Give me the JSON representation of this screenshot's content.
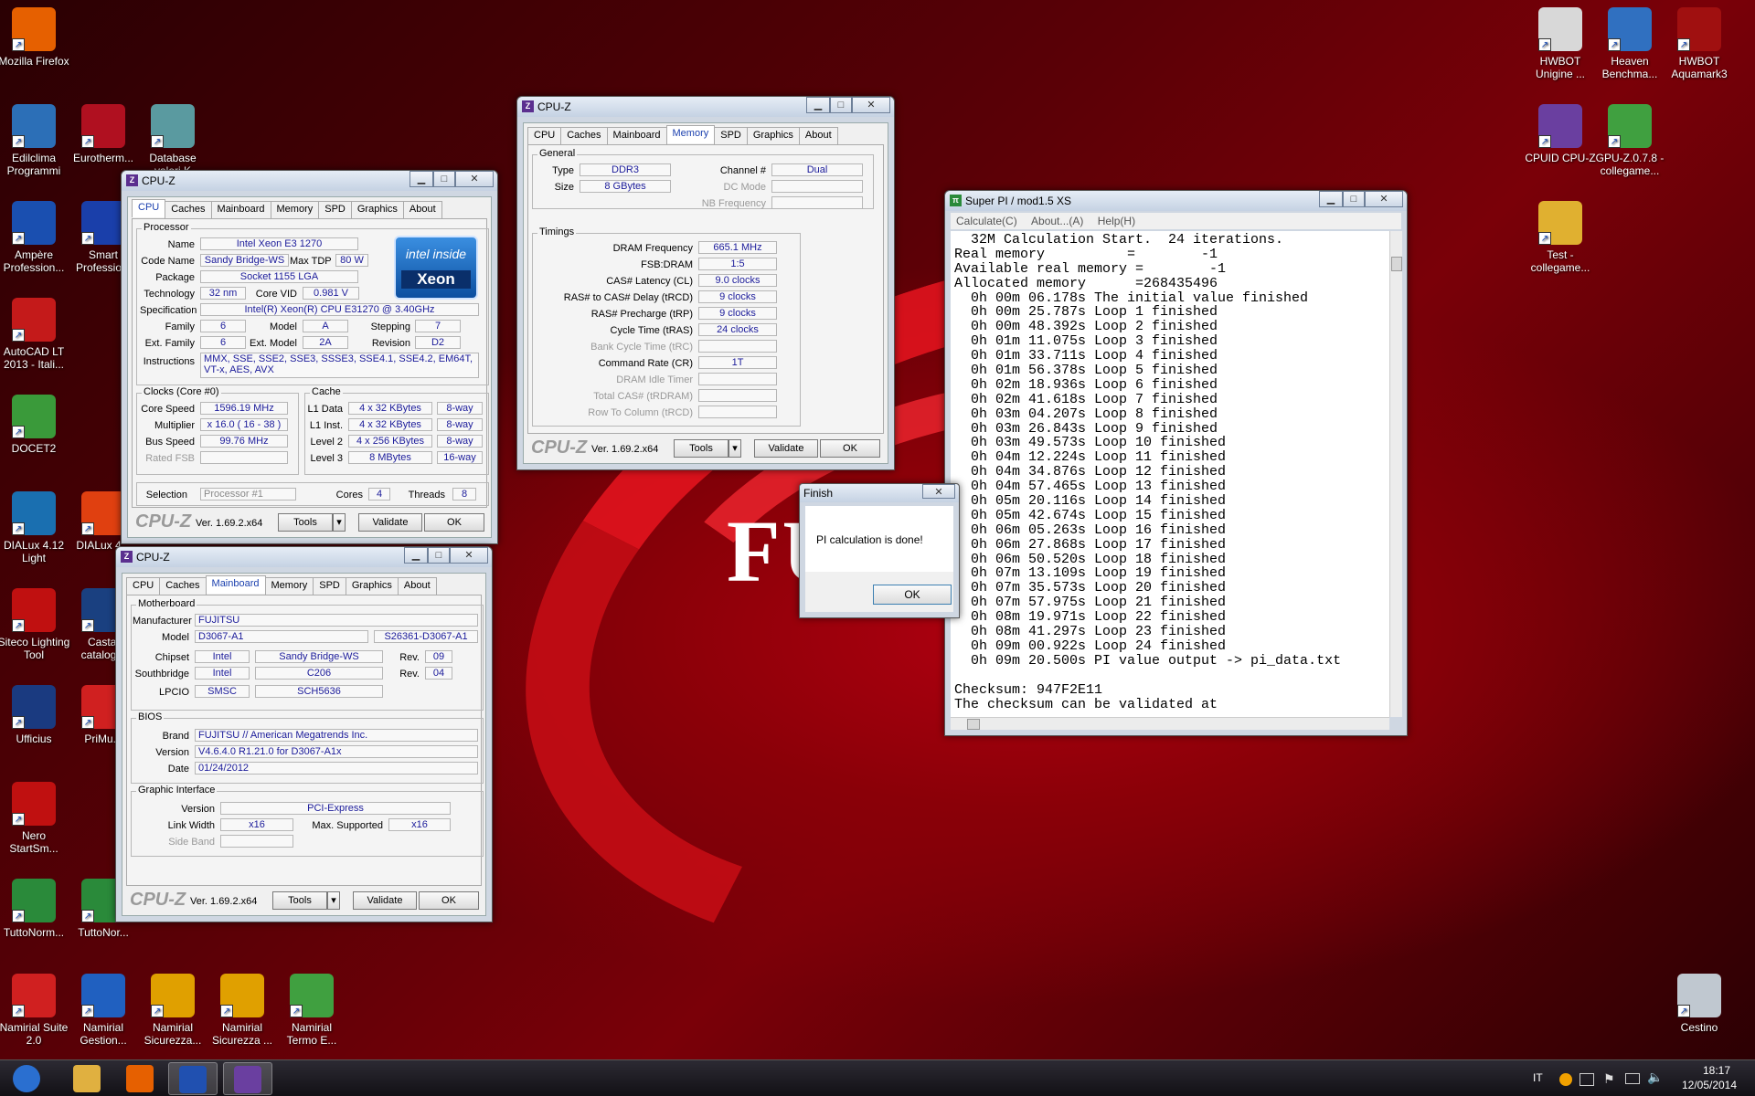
{
  "wallpaper": {
    "brand": "FUJ"
  },
  "desktop_icons": [
    {
      "label": "Mozilla Firefox",
      "icon": "firefox-icon",
      "color": "#e66000"
    },
    {
      "label": "Edilclima Programmi",
      "icon": "edilclima-icon",
      "color": "#2c6fb7"
    },
    {
      "label": "Eurotherm...",
      "icon": "eurotherm-icon",
      "color": "#b01020"
    },
    {
      "label": "Database valori K",
      "icon": "database-icon",
      "color": "#5a9aa0"
    },
    {
      "label": "Ampère Profession...",
      "icon": "ampere-icon",
      "color": "#1a4fb0"
    },
    {
      "label": "Smart Professio...",
      "icon": "smart-icon",
      "color": "#1a3faa"
    },
    {
      "label": "AutoCAD LT 2013 - Itali...",
      "icon": "autocad-icon",
      "color": "#c41a1a"
    },
    {
      "label": "DOCET2",
      "icon": "docet-icon",
      "color": "#3a9a3a"
    },
    {
      "label": "DIALux 4.12 Light",
      "icon": "dialux-icon",
      "color": "#1a6fb0"
    },
    {
      "label": "DIALux 4...",
      "icon": "dialux2-icon",
      "color": "#e04010"
    },
    {
      "label": "Siteco Lighting Tool",
      "icon": "siteco-icon",
      "color": "#c01010"
    },
    {
      "label": "Castal catalog...",
      "icon": "castal-icon",
      "color": "#1a4080"
    },
    {
      "label": "Ufficius",
      "icon": "ufficius-icon",
      "color": "#1a3a80"
    },
    {
      "label": "PriMu...",
      "icon": "primus-icon",
      "color": "#d02020"
    },
    {
      "label": "Nero StartSm...",
      "icon": "nero-icon",
      "color": "#c01010"
    },
    {
      "label": "TuttoNorm...",
      "icon": "tuttonorm-icon",
      "color": "#2a8a3a"
    },
    {
      "label": "TuttoNor...",
      "icon": "tuttonorm2-icon",
      "color": "#2a8a3a"
    },
    {
      "label": "Namirial Suite 2.0",
      "icon": "namirial-icon",
      "color": "#d02020"
    },
    {
      "label": "Namirial Gestion...",
      "icon": "namirial-gestion-icon",
      "color": "#2060c0"
    },
    {
      "label": "Namirial Sicurezza...",
      "icon": "namirial-sicurezza-icon",
      "color": "#e0a000"
    },
    {
      "label": "Namirial Sicurezza ...",
      "icon": "namirial-sicurezza2-icon",
      "color": "#e0a000"
    },
    {
      "label": "Namirial Termo E...",
      "icon": "namirial-termo-icon",
      "color": "#40a040"
    },
    {
      "label": "HWBOT Unigine ...",
      "icon": "hwbot-unigine-icon",
      "color": "#d8d8d8"
    },
    {
      "label": "Heaven Benchma...",
      "icon": "heaven-icon",
      "color": "#3070c0"
    },
    {
      "label": "HWBOT Aquamark3",
      "icon": "aquamark-icon",
      "color": "#a01010"
    },
    {
      "label": "CPUID CPU-Z",
      "icon": "cpuz-icon",
      "color": "#6a3fa0"
    },
    {
      "label": "GPU-Z.0.7.8 - collegame...",
      "icon": "gpuz-icon",
      "color": "#40a040"
    },
    {
      "label": "Test - collegame...",
      "icon": "folder-icon",
      "color": "#e0b030"
    },
    {
      "label": "Cestino",
      "icon": "recycle-bin-icon",
      "color": "#c0c8d0"
    }
  ],
  "cpuz_cpu": {
    "title": "CPU-Z",
    "tabs": [
      "CPU",
      "Caches",
      "Mainboard",
      "Memory",
      "SPD",
      "Graphics",
      "About"
    ],
    "processor_label": "Processor",
    "name_label": "Name",
    "name": "Intel Xeon E3 1270",
    "codename_label": "Code Name",
    "codename": "Sandy Bridge-WS",
    "maxtdp_label": "Max TDP",
    "maxtdp": "80 W",
    "package_label": "Package",
    "package": "Socket 1155 LGA",
    "tech_label": "Technology",
    "tech": "32 nm",
    "vid_label": "Core VID",
    "vid": "0.981 V",
    "spec_label": "Specification",
    "spec": "Intel(R) Xeon(R) CPU E31270 @ 3.40GHz",
    "family_label": "Family",
    "family": "6",
    "model_label": "Model",
    "model": "A",
    "stepping_label": "Stepping",
    "stepping": "7",
    "extfamily_label": "Ext. Family",
    "extfamily": "6",
    "extmodel_label": "Ext. Model",
    "extmodel": "2A",
    "revision_label": "Revision",
    "revision": "D2",
    "instr_label": "Instructions",
    "instr": "MMX, SSE, SSE2, SSE3, SSSE3, SSE4.1, SSE4.2, EM64T, VT-x, AES, AVX",
    "clocks_label": "Clocks (Core #0)",
    "corespeed_label": "Core Speed",
    "corespeed": "1596.19 MHz",
    "mult_label": "Multiplier",
    "mult": "x 16.0 ( 16 - 38 )",
    "bus_label": "Bus Speed",
    "bus": "99.76 MHz",
    "fsb_label": "Rated FSB",
    "fsb": "",
    "cache_label": "Cache",
    "l1d_label": "L1 Data",
    "l1d": "4 x 32 KBytes",
    "l1d_way": "8-way",
    "l1i_label": "L1 Inst.",
    "l1i": "4 x 32 KBytes",
    "l1i_way": "8-way",
    "l2_label": "Level 2",
    "l2": "4 x 256 KBytes",
    "l2_way": "8-way",
    "l3_label": "Level 3",
    "l3": "8 MBytes",
    "l3_way": "16-way",
    "selection_label": "Selection",
    "selection": "Processor #1",
    "cores_label": "Cores",
    "cores": "4",
    "threads_label": "Threads",
    "threads": "8",
    "logo": "CPU-Z",
    "version": "Ver. 1.69.2.x64",
    "tools": "Tools",
    "validate": "Validate",
    "ok": "OK",
    "intel_inside": "intel inside",
    "intel_xeon": "Xeon"
  },
  "cpuz_mem": {
    "title": "CPU-Z",
    "tabs": [
      "CPU",
      "Caches",
      "Mainboard",
      "Memory",
      "SPD",
      "Graphics",
      "About"
    ],
    "general_label": "General",
    "type_label": "Type",
    "type": "DDR3",
    "size_label": "Size",
    "size": "8 GBytes",
    "channel_label": "Channel #",
    "channel": "Dual",
    "dcmode_label": "DC Mode",
    "nbfreq_label": "NB Frequency",
    "timings_label": "Timings",
    "rows": [
      {
        "label": "DRAM Frequency",
        "value": "665.1 MHz",
        "dis": false
      },
      {
        "label": "FSB:DRAM",
        "value": "1:5",
        "dis": false
      },
      {
        "label": "CAS# Latency (CL)",
        "value": "9.0 clocks",
        "dis": false
      },
      {
        "label": "RAS# to CAS# Delay (tRCD)",
        "value": "9 clocks",
        "dis": false
      },
      {
        "label": "RAS# Precharge (tRP)",
        "value": "9 clocks",
        "dis": false
      },
      {
        "label": "Cycle Time (tRAS)",
        "value": "24 clocks",
        "dis": false
      },
      {
        "label": "Bank Cycle Time (tRC)",
        "value": "",
        "dis": true
      },
      {
        "label": "Command Rate (CR)",
        "value": "1T",
        "dis": false
      },
      {
        "label": "DRAM Idle Timer",
        "value": "",
        "dis": true
      },
      {
        "label": "Total CAS# (tRDRAM)",
        "value": "",
        "dis": true
      },
      {
        "label": "Row To Column (tRCD)",
        "value": "",
        "dis": true
      }
    ],
    "logo": "CPU-Z",
    "version": "Ver. 1.69.2.x64",
    "tools": "Tools",
    "validate": "Validate",
    "ok": "OK"
  },
  "cpuz_mb": {
    "title": "CPU-Z",
    "tabs": [
      "CPU",
      "Caches",
      "Mainboard",
      "Memory",
      "SPD",
      "Graphics",
      "About"
    ],
    "motherboard_label": "Motherboard",
    "manufacturer_label": "Manufacturer",
    "manufacturer": "FUJITSU",
    "model_label": "Model",
    "model": "D3067-A1",
    "model2": "S26361-D3067-A1",
    "chipset_label": "Chipset",
    "chipset_vendor": "Intel",
    "chipset": "Sandy Bridge-WS",
    "chipset_rev_label": "Rev.",
    "chipset_rev": "09",
    "south_label": "Southbridge",
    "south_vendor": "Intel",
    "south": "C206",
    "south_rev_label": "Rev.",
    "south_rev": "04",
    "lpcio_label": "LPCIO",
    "lpcio_vendor": "SMSC",
    "lpcio": "SCH5636",
    "bios_label": "BIOS",
    "brand_label": "Brand",
    "brand": "FUJITSU // American Megatrends Inc.",
    "version_label": "Version",
    "bios_version": "V4.6.4.0 R1.21.0 for D3067-A1x",
    "date_label": "Date",
    "date": "01/24/2012",
    "gi_label": "Graphic Interface",
    "giver_label": "Version",
    "giver": "PCI-Express",
    "lw_label": "Link Width",
    "lw": "x16",
    "maxsup_label": "Max. Supported",
    "maxsup": "x16",
    "sideband_label": "Side Band",
    "logo": "CPU-Z",
    "version": "Ver. 1.69.2.x64",
    "tools": "Tools",
    "validate": "Validate",
    "ok": "OK"
  },
  "superpi": {
    "title": "Super PI / mod1.5 XS",
    "menu": [
      "Calculate(C)",
      "About...(A)",
      "Help(H)"
    ],
    "lines": [
      "  32M Calculation Start.  24 iterations.",
      "Real memory          =        -1",
      "Available real memory =        -1",
      "Allocated memory      =268435496",
      "  0h 00m 06.178s The initial value finished",
      "  0h 00m 25.787s Loop 1 finished",
      "  0h 00m 48.392s Loop 2 finished",
      "  0h 01m 11.075s Loop 3 finished",
      "  0h 01m 33.711s Loop 4 finished",
      "  0h 01m 56.378s Loop 5 finished",
      "  0h 02m 18.936s Loop 6 finished",
      "  0h 02m 41.618s Loop 7 finished",
      "  0h 03m 04.207s Loop 8 finished",
      "  0h 03m 26.843s Loop 9 finished",
      "  0h 03m 49.573s Loop 10 finished",
      "  0h 04m 12.224s Loop 11 finished",
      "  0h 04m 34.876s Loop 12 finished",
      "  0h 04m 57.465s Loop 13 finished",
      "  0h 05m 20.116s Loop 14 finished",
      "  0h 05m 42.674s Loop 15 finished",
      "  0h 06m 05.263s Loop 16 finished",
      "  0h 06m 27.868s Loop 17 finished",
      "  0h 06m 50.520s Loop 18 finished",
      "  0h 07m 13.109s Loop 19 finished",
      "  0h 07m 35.573s Loop 20 finished",
      "  0h 07m 57.975s Loop 21 finished",
      "  0h 08m 19.971s Loop 22 finished",
      "  0h 08m 41.297s Loop 23 finished",
      "  0h 09m 00.922s Loop 24 finished",
      "  0h 09m 20.500s PI value output -> pi_data.txt",
      "",
      "Checksum: 947F2E11",
      "The checksum can be validated at"
    ]
  },
  "finish": {
    "title": "Finish",
    "message": "PI calculation is done!",
    "ok": "OK"
  },
  "taskbar": {
    "items": [
      {
        "icon": "start-orb-icon",
        "color": "#2a6fd0"
      },
      {
        "icon": "explorer-icon",
        "color": "#e0b040"
      },
      {
        "icon": "firefox-icon",
        "color": "#e66000"
      },
      {
        "icon": "superpi-icon",
        "color": "#2050b0"
      },
      {
        "icon": "cpuz-icon",
        "color": "#6a3fa0"
      }
    ],
    "lang": "IT",
    "time": "18:17",
    "date": "12/05/2014"
  }
}
